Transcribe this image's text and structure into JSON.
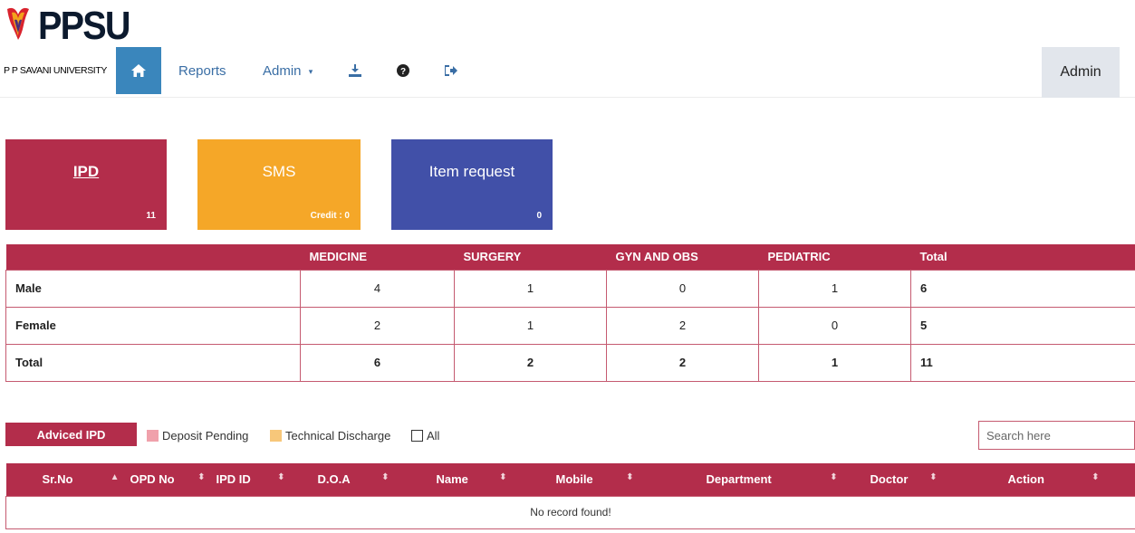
{
  "header": {
    "logo_text": "PPSU",
    "logo_subtitle": "P P SAVANI UNIVERSITY",
    "nav": {
      "home_icon": "home-icon",
      "reports": "Reports",
      "admin_menu": "Admin",
      "download_icon": "download-icon",
      "help_icon": "help-icon",
      "logout_icon": "logout-icon"
    },
    "user_label": "Admin"
  },
  "tiles": [
    {
      "title": "IPD",
      "count": "11",
      "color": "#b32d4b"
    },
    {
      "title": "SMS",
      "count": "Credit : 0",
      "color": "#f5a728"
    },
    {
      "title": "Item request",
      "count": "0",
      "color": "#4150a8"
    }
  ],
  "dept_table": {
    "headers": [
      "",
      "MEDICINE",
      "SURGERY",
      "GYN AND OBS",
      "PEDIATRIC",
      "Total"
    ],
    "rows": [
      {
        "label": "Male",
        "values": [
          "4",
          "1",
          "0",
          "1",
          "6"
        ]
      },
      {
        "label": "Female",
        "values": [
          "2",
          "1",
          "2",
          "0",
          "5"
        ]
      },
      {
        "label": "Total",
        "values": [
          "6",
          "2",
          "2",
          "1",
          "11"
        ]
      }
    ]
  },
  "filters": {
    "advised_button": "Adviced IPD",
    "legend": [
      {
        "label": "Deposit Pending",
        "color": "#f0a1ab"
      },
      {
        "label": "Technical Discharge",
        "color": "#f7c77a"
      }
    ],
    "all_label": "All",
    "search_placeholder": "Search here"
  },
  "records_table": {
    "columns": [
      "Sr.No",
      "OPD No",
      "IPD ID",
      "D.O.A",
      "Name",
      "Mobile",
      "Department",
      "Doctor",
      "Action"
    ],
    "sort_icons": [
      "▲",
      "⬍",
      "⬍",
      "⬍",
      "⬍",
      "⬍",
      "⬍",
      "⬍",
      "⬍"
    ],
    "empty_message": "No record found!"
  },
  "colors": {
    "primary": "#b32d4b",
    "accent": "#f5a728",
    "blue": "#4150a8",
    "home_button": "#3a86bc"
  }
}
